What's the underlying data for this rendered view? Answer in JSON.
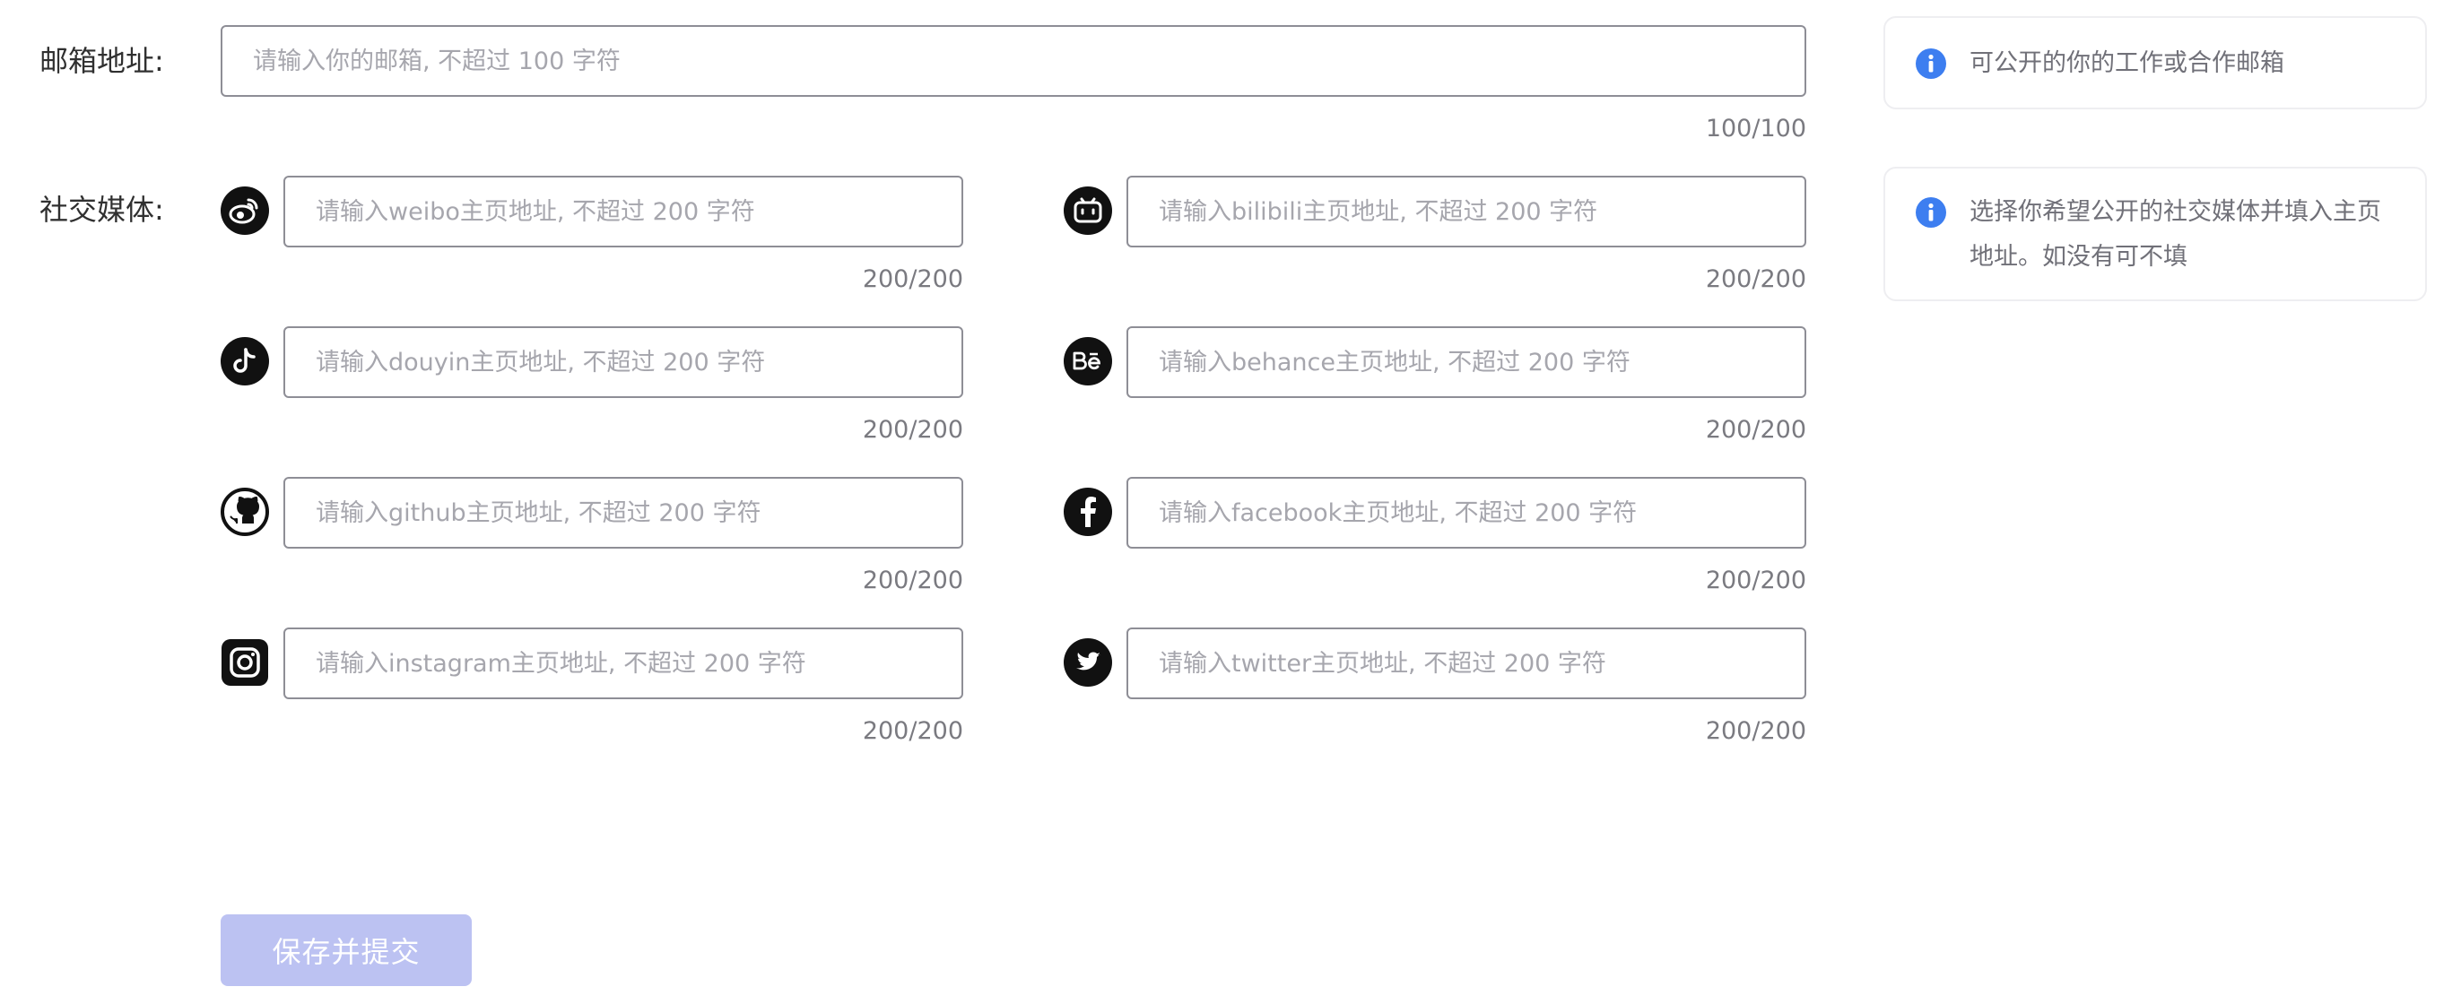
{
  "email": {
    "label": "邮箱地址:",
    "placeholder": "请输入你的邮箱, 不超过 100 字符",
    "value": "",
    "counter": "100/100",
    "info": "可公开的你的工作或合作邮箱"
  },
  "social": {
    "label": "社交媒体:",
    "info": "选择你希望公开的社交媒体并填入主页地址。如没有可不填",
    "items": [
      {
        "platform": "weibo",
        "icon": "weibo-icon",
        "placeholder": "请输入weibo主页地址, 不超过 200 字符",
        "value": "",
        "counter": "200/200"
      },
      {
        "platform": "bilibili",
        "icon": "bilibili-icon",
        "placeholder": "请输入bilibili主页地址, 不超过 200 字符",
        "value": "",
        "counter": "200/200"
      },
      {
        "platform": "douyin",
        "icon": "douyin-icon",
        "placeholder": "请输入douyin主页地址, 不超过 200 字符",
        "value": "",
        "counter": "200/200"
      },
      {
        "platform": "behance",
        "icon": "behance-icon",
        "placeholder": "请输入behance主页地址, 不超过 200 字符",
        "value": "",
        "counter": "200/200"
      },
      {
        "platform": "github",
        "icon": "github-icon",
        "placeholder": "请输入github主页地址, 不超过 200 字符",
        "value": "",
        "counter": "200/200"
      },
      {
        "platform": "facebook",
        "icon": "facebook-icon",
        "placeholder": "请输入facebook主页地址, 不超过 200 字符",
        "value": "",
        "counter": "200/200"
      },
      {
        "platform": "instagram",
        "icon": "instagram-icon",
        "placeholder": "请输入instagram主页地址, 不超过 200 字符",
        "value": "",
        "counter": "200/200"
      },
      {
        "platform": "twitter",
        "icon": "twitter-icon",
        "placeholder": "请输入twitter主页地址, 不超过 200 字符",
        "value": "",
        "counter": "200/200"
      }
    ]
  },
  "submit": {
    "label": "保存并提交",
    "disabled": true
  },
  "colors": {
    "accent_disabled": "#bcc2f2",
    "info_icon": "#3d7ef0",
    "input_border": "#8e8e96",
    "icon_fill": "#111111"
  }
}
